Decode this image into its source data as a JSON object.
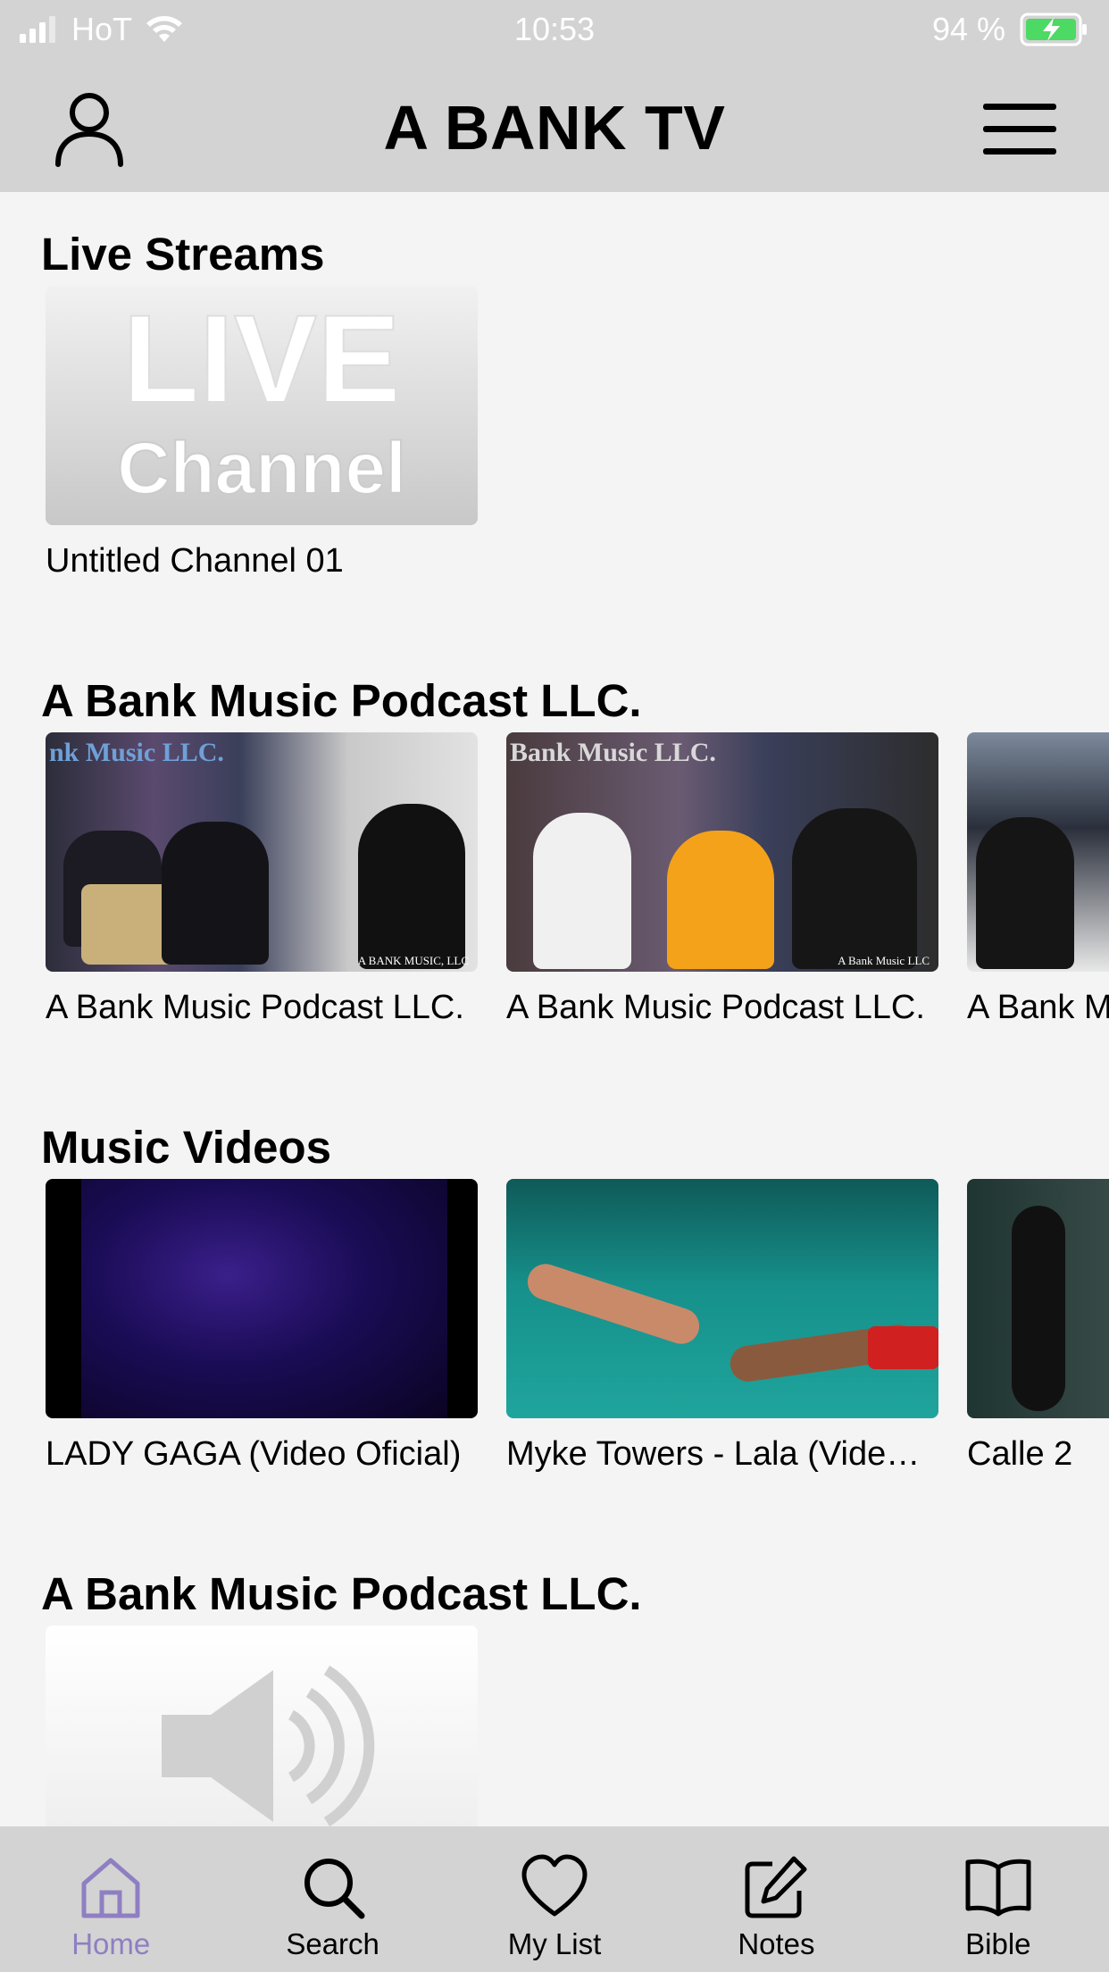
{
  "status": {
    "carrier": "HoT",
    "time": "10:53",
    "battery": "94 %"
  },
  "header": {
    "title": "A BANK TV",
    "icons": {
      "profile": "person-icon",
      "menu": "hamburger-icon"
    }
  },
  "sections": [
    {
      "title": "Live Streams",
      "items": [
        {
          "title": "Untitled Channel 01",
          "thumb_text_line1": "LIVE",
          "thumb_text_line2": "Channel"
        }
      ]
    },
    {
      "title": "A Bank Music Podcast LLC.",
      "items": [
        {
          "title": "A Bank Music Podcast LLC.",
          "watermark": "A BANK MUSIC, LLC",
          "banner": "nk Music LLC."
        },
        {
          "title": "A Bank Music Podcast LLC.",
          "watermark": "A Bank Music LLC",
          "banner": "Bank Music LLC."
        },
        {
          "title": "A Bank Music Podcast LLC."
        }
      ]
    },
    {
      "title": "Music Videos",
      "items": [
        {
          "title": "LADY GAGA (Video Oficial)"
        },
        {
          "title": "Myke Towers - Lala (Video Oficial)"
        },
        {
          "title": "Calle 2"
        }
      ]
    },
    {
      "title": "A Bank Music Podcast LLC.",
      "items": [
        {
          "title": "",
          "icon": "speaker-icon"
        }
      ]
    }
  ],
  "nav": {
    "items": [
      {
        "label": "Home",
        "icon": "home-icon",
        "active": true
      },
      {
        "label": "Search",
        "icon": "search-icon",
        "active": false
      },
      {
        "label": "My List",
        "icon": "heart-icon",
        "active": false
      },
      {
        "label": "Notes",
        "icon": "edit-icon",
        "active": false
      },
      {
        "label": "Bible",
        "icon": "book-icon",
        "active": false
      }
    ]
  },
  "colors": {
    "header_bg": "#d3d3d3",
    "page_bg": "#f4f4f4",
    "active_nav": "#8f7fc2",
    "battery_green": "#4cd964"
  }
}
